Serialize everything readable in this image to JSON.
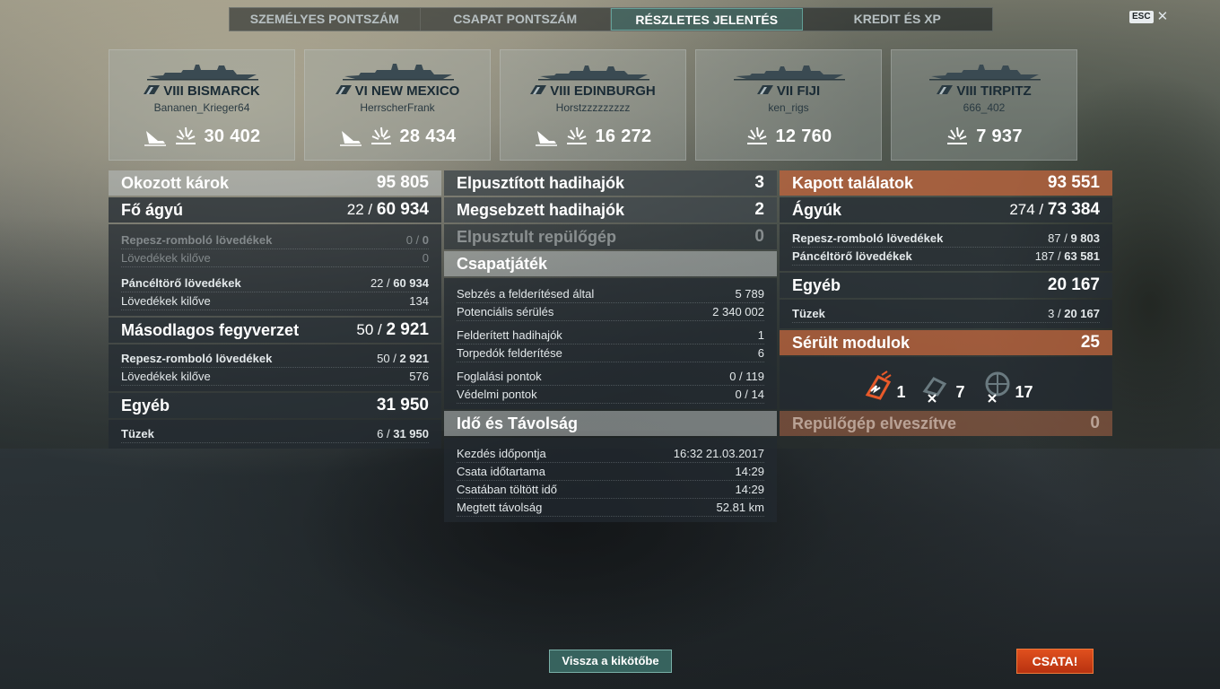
{
  "tabs": [
    {
      "label": "SZEMÉLYES PONTSZÁM"
    },
    {
      "label": "CSAPAT PONTSZÁM"
    },
    {
      "label": "RÉSZLETES JELENTÉS"
    },
    {
      "label": "KREDIT ÉS XP"
    }
  ],
  "active_tab": "RÉSZLETES JELENTÉS",
  "esc": {
    "key": "ESC",
    "close": "✕"
  },
  "ships": [
    {
      "name": "VIII BISMARCK",
      "player": "Bananen_Krieger64",
      "damage": "30 402",
      "icons": [
        "sunk-ship-icon",
        "damage-icon"
      ]
    },
    {
      "name": "VI NEW MEXICO",
      "player": "HerrscherFrank",
      "damage": "28 434",
      "icons": [
        "sunk-ship-icon",
        "damage-icon"
      ]
    },
    {
      "name": "VIII EDINBURGH",
      "player": "Horstzzzzzzzzz",
      "damage": "16 272",
      "icons": [
        "sunk-ship-icon",
        "damage-icon"
      ]
    },
    {
      "name": "VII FIJI",
      "player": "ken_rigs",
      "damage": "12 760",
      "icons": [
        "damage-icon"
      ]
    },
    {
      "name": "VIII TIRPITZ",
      "player": "666_402",
      "damage": "7 937",
      "icons": [
        "damage-icon"
      ]
    }
  ],
  "left": {
    "caused": {
      "label": "Okozott károk",
      "value": "95 805"
    },
    "main": {
      "label": "Fő ágyú",
      "pre": "22 / ",
      "total": "60 934"
    },
    "main_rows": [
      {
        "label": "Repesz-romboló lövedékek",
        "pre": "0 / ",
        "val": "0"
      },
      {
        "label": "Lövedékek kilőve",
        "pre": "",
        "val": "0"
      },
      {
        "label": "Páncéltörő lövedékek",
        "pre": "22 / ",
        "val": "60 934"
      },
      {
        "label": "Lövedékek kilőve",
        "pre": "",
        "val": "134"
      }
    ],
    "secondary": {
      "label": "Másodlagos fegyverzet",
      "pre": "50 / ",
      "total": "2 921"
    },
    "secondary_rows": [
      {
        "label": "Repesz-romboló lövedékek",
        "pre": "50 / ",
        "val": "2 921"
      },
      {
        "label": "Lövedékek kilőve",
        "pre": "",
        "val": "576"
      }
    ],
    "other": {
      "label": "Egyéb",
      "value": "31 950"
    },
    "other_rows": [
      {
        "label": "Tüzek",
        "pre": "6 / ",
        "val": "31 950"
      }
    ]
  },
  "middle": {
    "destroyed": {
      "label": "Elpusztított hadihajók",
      "value": "3"
    },
    "damaged": {
      "label": "Megsebzett hadihajók",
      "value": "2"
    },
    "planes": {
      "label": "Elpusztult repülőgép",
      "value": "0"
    },
    "team": {
      "label": "Csapatjáték"
    },
    "team_rows": [
      {
        "label": "Sebzés a felderítésed által",
        "val": "5 789"
      },
      {
        "label": "Potenciális sérülés",
        "val": "2 340 002"
      },
      {
        "label": "Felderített hadihajók",
        "val": "1"
      },
      {
        "label": "Torpedók felderítése",
        "val": "6"
      },
      {
        "label": "Foglalási pontok",
        "val": "0 / 119"
      },
      {
        "label": "Védelmi pontok",
        "val": "0 / 14"
      }
    ],
    "time": {
      "label": "Idő és Távolság"
    },
    "time_rows": [
      {
        "label": "Kezdés időpontja",
        "val": "16:32  21.03.2017"
      },
      {
        "label": "Csata időtartama",
        "val": "14:29"
      },
      {
        "label": "Csatában töltött idő",
        "val": "14:29"
      },
      {
        "label": "Megtett távolság",
        "val": "52.81 km"
      }
    ]
  },
  "right": {
    "received": {
      "label": "Kapott találatok",
      "value": "93 551"
    },
    "guns": {
      "label": "Ágyúk",
      "pre": "274 / ",
      "total": "73 384"
    },
    "guns_rows": [
      {
        "label": "Repesz-romboló lövedékek",
        "pre": "87 / ",
        "val": "9 803"
      },
      {
        "label": "Páncéltörő lövedékek",
        "pre": "187 / ",
        "val": "63 581"
      }
    ],
    "other": {
      "label": "Egyéb",
      "value": "20 167"
    },
    "other_rows": [
      {
        "label": "Tüzek",
        "pre": "3 / ",
        "val": "20 167"
      }
    ],
    "modules": {
      "label": "Sérült modulok",
      "value": "25"
    },
    "module_items": [
      {
        "icon": "damaged-module-icon",
        "count": "1"
      },
      {
        "icon": "destroyed-module-icon",
        "count": "7"
      },
      {
        "icon": "destroyed-turret-icon",
        "count": "17"
      }
    ],
    "planes_lost": {
      "label": "Repülőgép elveszítve",
      "value": "0"
    }
  },
  "buttons": {
    "port": "Vissza a kikötőbe",
    "battle": "CSATA!"
  },
  "colors": {
    "accent_teal": "#46786f",
    "orange_header": "#be643c",
    "battle_button": "#d04418"
  }
}
